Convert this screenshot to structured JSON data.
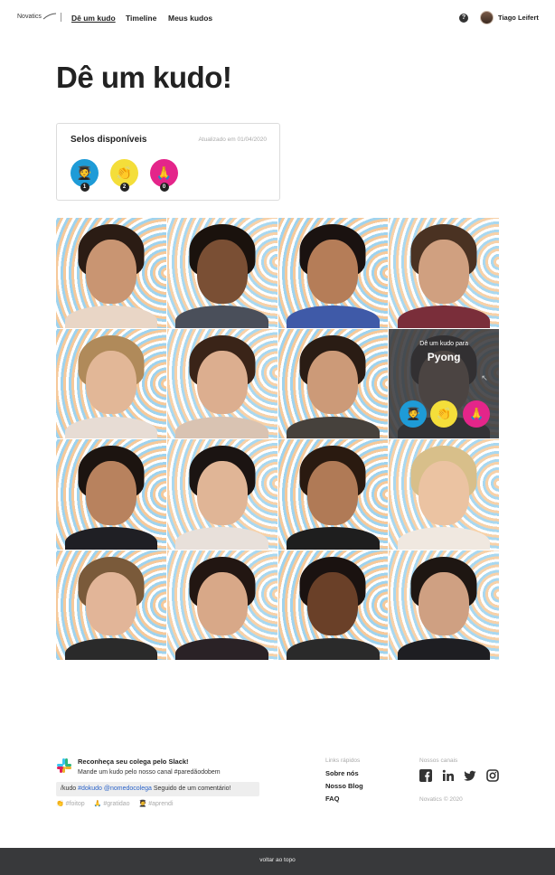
{
  "header": {
    "logo_text": "Novatics",
    "nav": [
      "Dê um kudo",
      "Timeline",
      "Meus kudos"
    ],
    "active_nav": "Dê um kudo",
    "help_label": "?",
    "user_name": "Tiago Leifert"
  },
  "page_title": "Dê um kudo!",
  "badges_card": {
    "title": "Selos disponíveis",
    "updated": "Atualizado em 01/04/2020",
    "badges": [
      {
        "icon": "graduation-emoji-icon",
        "glyph": "🧑‍🎓",
        "color": "#1e9bd7",
        "count": "1"
      },
      {
        "icon": "clapping-hands-icon",
        "glyph": "👏",
        "color": "#f4de3a",
        "count": "2"
      },
      {
        "icon": "folded-hands-icon",
        "glyph": "🙏",
        "color": "#e4258a",
        "count": "0"
      }
    ]
  },
  "grid": {
    "overlay": {
      "caption": "Dê um kudo para",
      "name": "Pyong",
      "index": 7
    },
    "tiles": [
      {
        "skin": "#c99572",
        "hair": "#2b1c14",
        "shirt": "#e9d6c6"
      },
      {
        "skin": "#7a4f34",
        "hair": "#1a120d",
        "shirt": "#4a4f5a"
      },
      {
        "skin": "#b57d58",
        "hair": "#1a1210",
        "shirt": "#3f5aa8"
      },
      {
        "skin": "#d0a080",
        "hair": "#4a3222",
        "shirt": "#7a2e3a"
      },
      {
        "skin": "#e2b797",
        "hair": "#b08a5a",
        "shirt": "#e7dcd4"
      },
      {
        "skin": "#dcae8f",
        "hair": "#3a2418",
        "shirt": "#d9c3b2"
      },
      {
        "skin": "#cc9a78",
        "hair": "#2a1c14",
        "shirt": "#46413c"
      },
      {
        "skin": "#d2a47f",
        "hair": "#231914",
        "shirt": "#2a2a2a"
      },
      {
        "skin": "#b8825e",
        "hair": "#1c1410",
        "shirt": "#1f1f24"
      },
      {
        "skin": "#e0b596",
        "hair": "#1b1412",
        "shirt": "#e8e0da"
      },
      {
        "skin": "#b07a56",
        "hair": "#2a1a10",
        "shirt": "#1e1e1e"
      },
      {
        "skin": "#ebc3a2",
        "hair": "#d8bf8a",
        "shirt": "#f0e8e0"
      },
      {
        "skin": "#e2b598",
        "hair": "#7a5a3a",
        "shirt": "#2a2a2a"
      },
      {
        "skin": "#d8a888",
        "hair": "#221612",
        "shirt": "#2a2226"
      },
      {
        "skin": "#6a4028",
        "hair": "#1a1210",
        "shirt": "#2a2a2a"
      },
      {
        "skin": "#cfa082",
        "hair": "#1e1612",
        "shirt": "#1e1e22"
      }
    ]
  },
  "footer": {
    "slack_title": "Reconheça seu colega pelo Slack!",
    "slack_sub": "Mande um kudo pelo nosso canal #paredãodobem",
    "cmd_prefix": "/kudo",
    "cmd_tag1": "#dokudo",
    "cmd_tag2": "@nomedocolega",
    "cmd_suffix": "Seguido de um comentário!",
    "hashtags": [
      "#foitop",
      "#gratidao",
      "#aprendi"
    ],
    "hashtag_glyphs": [
      "👏",
      "🙏",
      "🧑‍🎓"
    ],
    "links_heading": "Links rápidos",
    "links": [
      "Sobre nós",
      "Nosso Blog",
      "FAQ"
    ],
    "channels_heading": "Nossos canais",
    "socials": [
      "facebook-icon",
      "linkedin-icon",
      "twitter-icon",
      "instagram-icon"
    ],
    "copyright": "Novatics © 2020",
    "back_to_top": "voltar ao topo"
  }
}
